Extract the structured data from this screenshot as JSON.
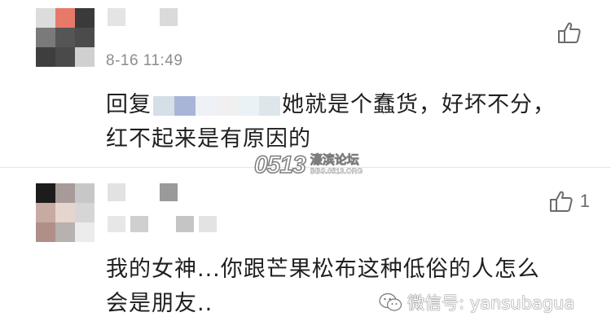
{
  "colors": {
    "background": "#ffffff",
    "text": "#1f1f1f",
    "meta": "#8c8c8c",
    "divider": "#e6e6e6",
    "like_icon": "#6b6b6b"
  },
  "comments": [
    {
      "timestamp": "8-16 11:49",
      "reply_prefix": "回复",
      "text_line": "她就是个蠢货，好坏不分，红不起来是有原因的",
      "likes": "",
      "avatar_tiles": [
        "#dcdcdc",
        "#e8796a",
        "#3a3a3a",
        "#7a7a7a",
        "#555555",
        "#4b4b4b",
        "#3e3e3e",
        "#4a4a4a",
        "#d0d0d0"
      ],
      "name_tiles": [
        "#e4e4e4",
        "#ffffff",
        "#dadada"
      ],
      "reply_tiles": [
        "#d6dee8",
        "#a9b5d8",
        "#eef1f6",
        "#f0f0f0",
        "#eaf2f6",
        "#dde6ea"
      ]
    },
    {
      "timestamp": "",
      "reply_prefix": "",
      "text_line": "我的女神...你跟芒果松布这种低俗的人怎么会是朋友..",
      "likes": "1",
      "avatar_tiles": [
        "#1c1c1c",
        "#a89a98",
        "#c7c7c7",
        "#c7aaa2",
        "#e6d4cf",
        "#d6d6d6",
        "#b08f88",
        "#b7b1b0",
        "#ececec"
      ],
      "name_tiles": [
        "#e2e2e2",
        "#ffffff",
        "#9a9a9a"
      ],
      "sub_tiles": [
        "#e7e7e7",
        "#cfcfcf",
        "#ffffff",
        "#c5c5c5",
        "#e3e3e3"
      ]
    }
  ],
  "watermarks": {
    "forum_logo": "0513",
    "forum_name": "濠滨论坛",
    "forum_url": "BBS.0513.ORG",
    "wechat": "微信号: yansubagua"
  },
  "icons": {
    "like": "thumbs-up-icon",
    "wechat": "wechat-icon"
  }
}
